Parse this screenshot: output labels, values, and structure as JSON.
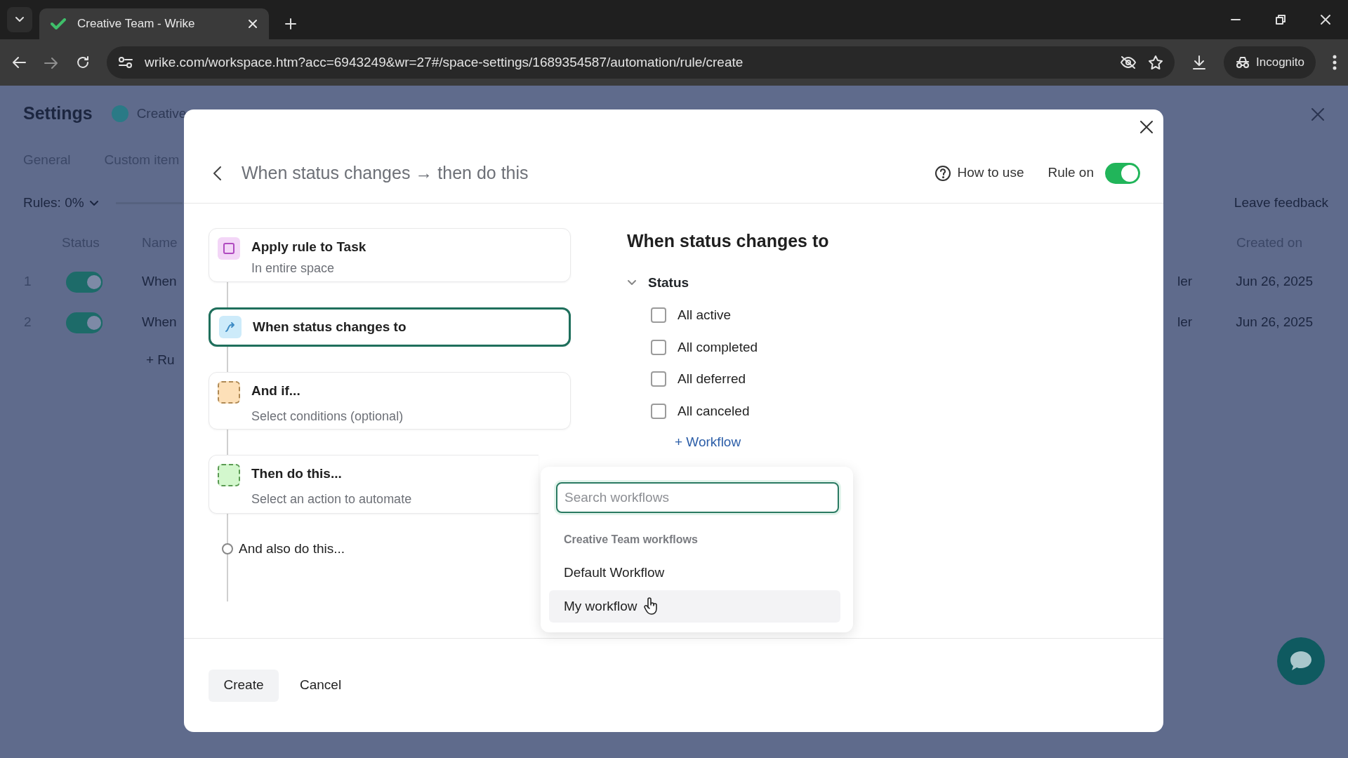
{
  "browser": {
    "tab_title": "Creative Team - Wrike",
    "url": "wrike.com/workspace.htm?acc=6943249&wr=27#/space-settings/1689354587/automation/rule/create",
    "profile_label": "Incognito"
  },
  "background": {
    "title": "Settings",
    "space": "Creative",
    "tabs": [
      "General",
      "Custom item"
    ],
    "rules_filter": "Rules: 0%",
    "leave_feedback": "Leave feedback",
    "columns": [
      "Status",
      "Name",
      "Created on"
    ],
    "rows": [
      {
        "index": "1",
        "on": true,
        "name": "When",
        "column_4": "ler",
        "created": "Jun 26, 2025"
      },
      {
        "index": "2",
        "on": true,
        "name": "When",
        "column_4": "ler",
        "created": "Jun 26, 2025"
      }
    ],
    "add_rule": "+ Ru"
  },
  "modal": {
    "title": "When status changes → then do this",
    "how_to_use": "How to use",
    "rule_label": "Rule on",
    "rule_on": true,
    "steps": [
      {
        "kind": "scope",
        "title": "Apply rule to Task",
        "subtitle": "In entire space",
        "selected": false,
        "color": "#f3d6f7"
      },
      {
        "kind": "trigger",
        "title": "When status changes to",
        "selected": true,
        "color": "#cdebfa"
      },
      {
        "kind": "condition",
        "title": "And if...",
        "subtitle": "Select conditions (optional)",
        "selected": false,
        "color": "#fde0b8"
      },
      {
        "kind": "action",
        "title": "Then do this...",
        "subtitle": "Select an action to automate",
        "selected": false,
        "color": "#d3f7cd"
      }
    ],
    "also": "And also do this...",
    "heading": "When status changes to",
    "status_group": {
      "label": "Status",
      "expanded": true,
      "options": [
        {
          "label": "All active",
          "checked": false
        },
        {
          "label": "All completed",
          "checked": false
        },
        {
          "label": "All deferred",
          "checked": false
        },
        {
          "label": "All canceled",
          "checked": false
        }
      ],
      "add_workflow": "+ Workflow"
    },
    "dropdown": {
      "placeholder": "Search workflows",
      "group_label": "Creative Team workflows",
      "items": [
        {
          "label": "Default Workflow",
          "hovered": false
        },
        {
          "label": "My workflow",
          "hovered": true
        }
      ]
    },
    "create": "Create",
    "cancel": "Cancel"
  }
}
